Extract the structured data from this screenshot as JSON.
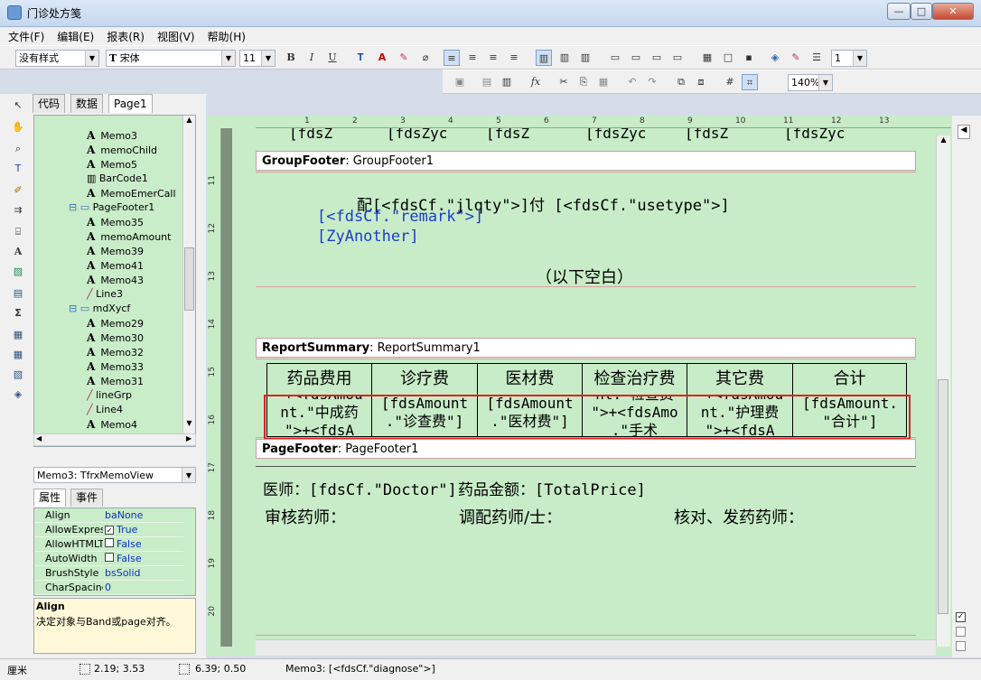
{
  "window": {
    "title": "门诊处方笺",
    "minimize": "—",
    "maximize": "□",
    "close": "✕"
  },
  "menu": [
    "文件(F)",
    "编辑(E)",
    "报表(R)",
    "视图(V)",
    "帮助(H)"
  ],
  "toolbar": {
    "style_value": "没有样式",
    "font_value": "宋体",
    "size_value": "11",
    "bold": "B",
    "italic": "I",
    "underline": "U",
    "frame_width": "1",
    "zoom": "140%"
  },
  "tabs": [
    "代码",
    "数据",
    "Page1"
  ],
  "tree": [
    {
      "label": "Memo3",
      "kind": "memo"
    },
    {
      "label": "memoChild",
      "kind": "memo"
    },
    {
      "label": "Memo5",
      "kind": "memo"
    },
    {
      "label": "BarCode1",
      "kind": "barcode"
    },
    {
      "label": "MemoEmerCall",
      "kind": "memo"
    },
    {
      "label": "PageFooter1",
      "kind": "band"
    },
    {
      "label": "Memo35",
      "kind": "memo"
    },
    {
      "label": "memoAmount",
      "kind": "memo"
    },
    {
      "label": "Memo39",
      "kind": "memo"
    },
    {
      "label": "Memo41",
      "kind": "memo"
    },
    {
      "label": "Memo43",
      "kind": "memo"
    },
    {
      "label": "Line3",
      "kind": "line"
    },
    {
      "label": "mdXycf",
      "kind": "band"
    },
    {
      "label": "Memo29",
      "kind": "memo"
    },
    {
      "label": "Memo30",
      "kind": "memo"
    },
    {
      "label": "Memo32",
      "kind": "memo"
    },
    {
      "label": "Memo33",
      "kind": "memo"
    },
    {
      "label": "Memo31",
      "kind": "memo"
    },
    {
      "label": "lineGrp",
      "kind": "line"
    },
    {
      "label": "Line4",
      "kind": "line"
    },
    {
      "label": "Memo4",
      "kind": "memo"
    }
  ],
  "object_selector": "Memo3: TfrxMemoView",
  "prop_tabs": [
    "属性",
    "事件"
  ],
  "props": [
    {
      "k": "Align",
      "v": "baNone",
      "check": null
    },
    {
      "k": "AllowExpress",
      "v": "True",
      "check": true
    },
    {
      "k": "AllowHTMLTa",
      "v": "False",
      "check": false
    },
    {
      "k": "AutoWidth",
      "v": "False",
      "check": false
    },
    {
      "k": "BrushStyle",
      "v": "bsSolid",
      "check": null
    },
    {
      "k": "CharSpacing",
      "v": "0",
      "check": null
    }
  ],
  "help": {
    "title": "Align",
    "text": "决定对象与Band或page对齐。"
  },
  "ruler": [
    "1",
    "2",
    "3",
    "4",
    "5",
    "6",
    "7",
    "8",
    "9",
    "10",
    "11",
    "12",
    "13"
  ],
  "vruler": [
    "11",
    "12",
    "13",
    "14",
    "15",
    "16",
    "17",
    "18",
    "19",
    "20"
  ],
  "top_strip": [
    "[fdsZ",
    "[fdsZyc",
    "[fdsZ",
    "[fdsZyc",
    "[fdsZ",
    "[fdsZyc"
  ],
  "group_footer": {
    "kind": "GroupFooter",
    "name": "GroupFooter1",
    "line1": "配[<fdsCf.\"jlqty\">]付 [<fdsCf.\"usetype\">]",
    "line2": "[<fdsCf.\"remark\">]",
    "line3": "[ZyAnother]",
    "blank": "（以下空白）"
  },
  "report_summary": {
    "kind": "ReportSummary",
    "name": "ReportSummary1",
    "headers": [
      "药品费用",
      "诊疗费",
      "医材费",
      "检查治疗费",
      "其它费",
      "合计"
    ],
    "cells": [
      "\"+<fdsAmou\nnt.\"中成药\n\">+<fdsA",
      "[fdsAmount\n.\"诊查费\"]",
      "[fdsAmount\n.\"医材费\"]",
      "nt.\"检查费\n\">+<fdsAmo\n.\"手术",
      "\"+<fdsAmou\nnt.\"护理费\n\">+<fdsA",
      "[fdsAmount.\n\"合计\"]"
    ]
  },
  "page_footer": {
    "kind": "PageFooter",
    "name": "PageFooter1",
    "doctor": "医师：[fdsCf.\"Doctor\"]",
    "price": "药品金额：[TotalPrice]",
    "review": "审核药师：",
    "dispense": "调配药师/士：",
    "check": "核对、发药药师："
  },
  "status": {
    "unit": "厘米",
    "pos": "2.19; 3.53",
    "size": "6.39; 0.50",
    "selection": "Memo3: [<fdsCf.\"diagnose\">]"
  },
  "colors": {
    "band_bg": "#c8ecc8",
    "highlight": "#e02020"
  }
}
